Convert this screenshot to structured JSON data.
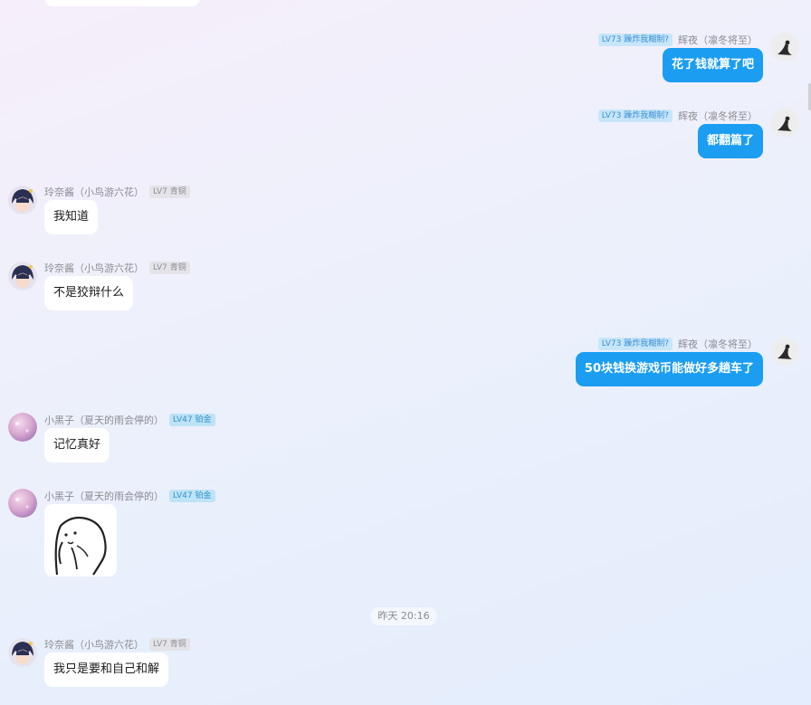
{
  "users": {
    "self": {
      "level_badge": "LV73 躁炸我糊制?",
      "name": "辉夜（凛冬将至）"
    },
    "lingnai": {
      "name": "玲奈酱（小鸟游六花）",
      "level_badge": "LV7 青铜"
    },
    "xiaoheizi": {
      "name": "小黑子（夏天的雨会停的）",
      "level_badge": "LV47 铂金"
    }
  },
  "messages": [
    {
      "text": "花了钱就算了吧"
    },
    {
      "text": "都翻篇了"
    },
    {
      "text": "我知道"
    },
    {
      "text": "不是狡辩什么"
    },
    {
      "text": "50块钱换游戏币能做好多趟车了"
    },
    {
      "text": "记忆真好"
    },
    {
      "sticker": "sticker-image"
    },
    {
      "text": "我只是要和自己和解"
    }
  ],
  "time_separator": "昨天 20:16",
  "colors": {
    "self_bubble": "#1b9df2",
    "other_bubble": "#ffffff",
    "background_start": "#f6eefb",
    "background_end": "#e3edfd"
  }
}
